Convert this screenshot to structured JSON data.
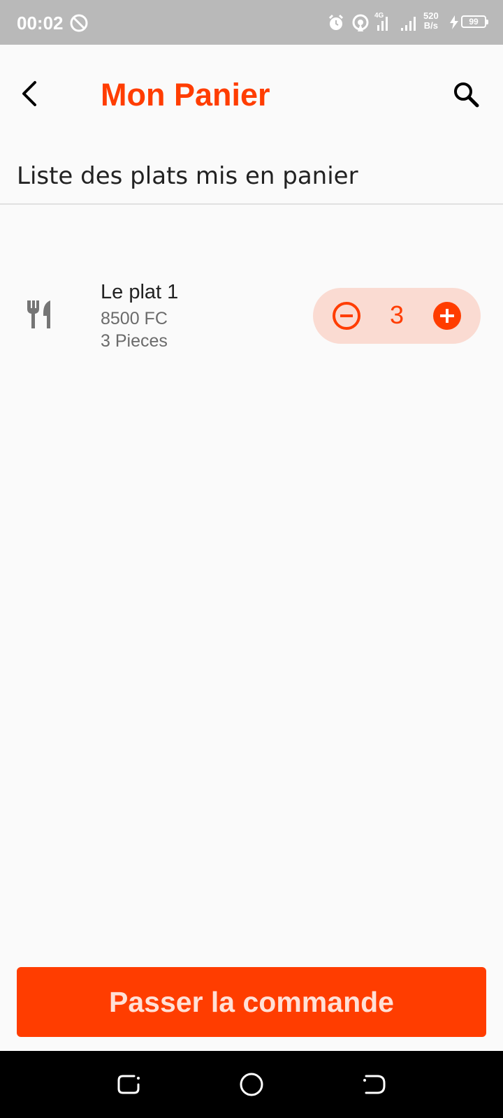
{
  "status_bar": {
    "time": "00:02",
    "network_speed_value": "520",
    "network_speed_unit": "B/s",
    "network_type": "4G",
    "battery_level": "99",
    "icons": [
      "do-not-disturb-icon",
      "alarm-icon",
      "hotspot-icon",
      "signal-icon",
      "signal-icon",
      "charging-icon",
      "battery-icon"
    ]
  },
  "app_bar": {
    "title": "Mon Panier",
    "back_icon": "chevron-left-icon",
    "search_icon": "search-icon"
  },
  "section": {
    "title": "Liste des plats mis en panier"
  },
  "cart": {
    "items": [
      {
        "name": "Le plat 1",
        "price": "8500 FC",
        "pieces": "3 Pieces",
        "quantity": "3",
        "icon": "utensils-icon"
      }
    ]
  },
  "actions": {
    "order_label": "Passer la commande"
  },
  "colors": {
    "accent": "#ff3d00",
    "stepper_bg": "#fadbd2",
    "status_bar": "#b9b9b9",
    "nav_bar": "#000000"
  },
  "nav_bar": {
    "icons": [
      "recents-icon",
      "home-icon",
      "back-icon"
    ]
  }
}
